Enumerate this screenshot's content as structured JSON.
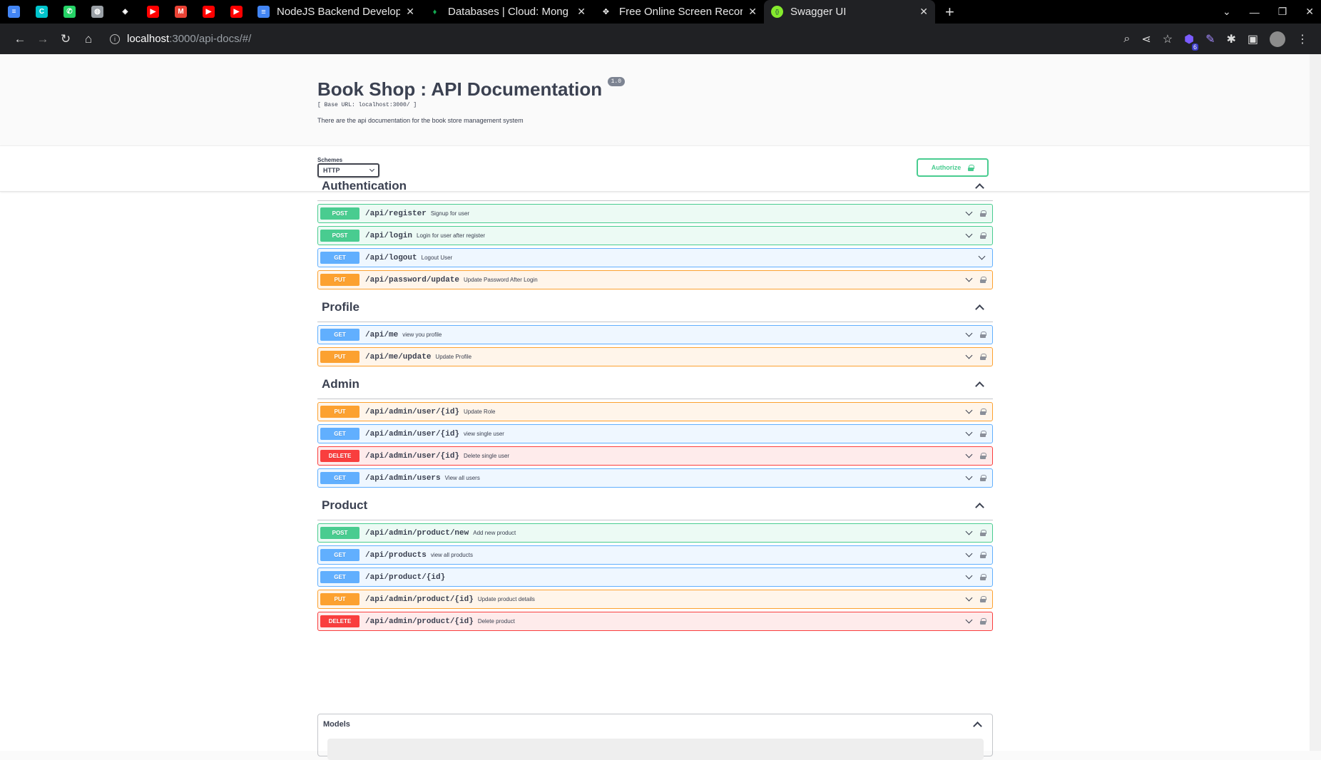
{
  "browser": {
    "pinned_tabs": [
      {
        "icon": "docs-icon",
        "color": "#4285f4"
      },
      {
        "icon": "canva-icon",
        "color": "#00c4cc"
      },
      {
        "icon": "whatsapp-icon",
        "color": "#25d366"
      },
      {
        "icon": "globe-icon",
        "color": "#9aa0a6"
      },
      {
        "icon": "app-icon",
        "color": "#ffffff"
      },
      {
        "icon": "youtube-icon",
        "color": "#ff0000"
      },
      {
        "icon": "gmail-icon",
        "color": "#ea4335"
      },
      {
        "icon": "youtube-icon",
        "color": "#ff0000"
      },
      {
        "icon": "youtube-icon",
        "color": "#ff0000"
      }
    ],
    "tabs": [
      {
        "title": "NodeJS Backend Develop",
        "icon": "docs-icon",
        "color": "#4285f4"
      },
      {
        "title": "Databases | Cloud: Mong",
        "icon": "mongodb-leaf-icon",
        "color": "#13aa52"
      },
      {
        "title": "Free Online Screen Recor",
        "icon": "recorder-icon",
        "color": "#ffffff"
      },
      {
        "title": "Swagger UI",
        "icon": "swagger-icon",
        "color": "#85ea2d"
      }
    ],
    "new_tab": "+",
    "address": {
      "host": "localhost",
      "rest": ":3000/api-docs/#/"
    },
    "extension_badge": "6"
  },
  "swagger": {
    "title": "Book Shop : API Documentation",
    "version": "1.0",
    "base_url": "[ Base URL: localhost:3000/ ]",
    "description": "There are the api documentation for the book store management system",
    "schemes_label": "Schemes",
    "scheme_value": "HTTP",
    "authorize_label": "Authorize",
    "colors": {
      "post": "#49cc90",
      "get": "#61affe",
      "put": "#fca130",
      "delete": "#f93e3e"
    },
    "tags": [
      {
        "name": "Authentication",
        "ops": [
          {
            "method": "POST",
            "path": "/api/register",
            "summary": "Signup for user",
            "locked": true
          },
          {
            "method": "POST",
            "path": "/api/login",
            "summary": "Login for user after register",
            "locked": true
          },
          {
            "method": "GET",
            "path": "/api/logout",
            "summary": "Logout User",
            "locked": false
          },
          {
            "method": "PUT",
            "path": "/api/password/update",
            "summary": "Update Password After Login",
            "locked": true
          }
        ]
      },
      {
        "name": "Profile",
        "ops": [
          {
            "method": "GET",
            "path": "/api/me",
            "summary": "view you profile",
            "locked": true
          },
          {
            "method": "PUT",
            "path": "/api/me/update",
            "summary": "Update Profile",
            "locked": true
          }
        ]
      },
      {
        "name": "Admin",
        "ops": [
          {
            "method": "PUT",
            "path": "/api/admin/user/{id}",
            "summary": "Update Role",
            "locked": true
          },
          {
            "method": "GET",
            "path": "/api/admin/user/{id}",
            "summary": "view single user",
            "locked": true
          },
          {
            "method": "DELETE",
            "path": "/api/admin/user/{id}",
            "summary": "Delete single user",
            "locked": true
          },
          {
            "method": "GET",
            "path": "/api/admin/users",
            "summary": "View all users",
            "locked": true
          }
        ]
      },
      {
        "name": "Product",
        "ops": [
          {
            "method": "POST",
            "path": "/api/admin/product/new",
            "summary": "Add new product",
            "locked": true
          },
          {
            "method": "GET",
            "path": "/api/products",
            "summary": "view all products",
            "locked": true
          },
          {
            "method": "GET",
            "path": "/api/product/{id}",
            "summary": "",
            "locked": true
          },
          {
            "method": "PUT",
            "path": "/api/admin/product/{id}",
            "summary": "Update product details",
            "locked": true
          },
          {
            "method": "DELETE",
            "path": "/api/admin/product/{id}",
            "summary": "Delete product",
            "locked": true
          }
        ]
      }
    ],
    "models_label": "Models"
  }
}
